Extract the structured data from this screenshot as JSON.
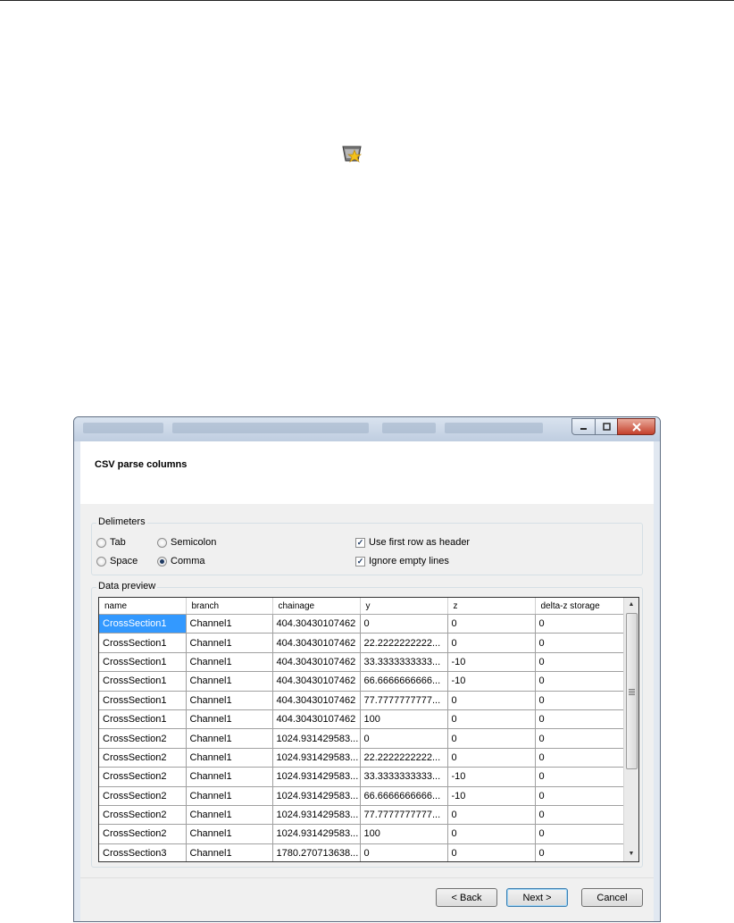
{
  "dialog": {
    "header_title": "CSV parse columns",
    "delimiters_group": {
      "label": "Delimeters",
      "options": [
        {
          "label": "Tab",
          "selected": false
        },
        {
          "label": "Semicolon",
          "selected": false
        },
        {
          "label": "Space",
          "selected": false
        },
        {
          "label": "Comma",
          "selected": true
        }
      ],
      "use_first_row_as_header": {
        "label": "Use first row as header",
        "checked": true
      },
      "ignore_empty_lines": {
        "label": "Ignore empty lines",
        "checked": true
      }
    },
    "preview": {
      "label": "Data preview",
      "columns": [
        "name",
        "branch",
        "chainage",
        "y",
        "z",
        "delta-z storage"
      ],
      "rows": [
        [
          "CrossSection1",
          "Channel1",
          "404.30430107462",
          "0",
          "0",
          "0"
        ],
        [
          "CrossSection1",
          "Channel1",
          "404.30430107462",
          "22.2222222222...",
          "0",
          "0"
        ],
        [
          "CrossSection1",
          "Channel1",
          "404.30430107462",
          "33.3333333333...",
          "-10",
          "0"
        ],
        [
          "CrossSection1",
          "Channel1",
          "404.30430107462",
          "66.6666666666...",
          "-10",
          "0"
        ],
        [
          "CrossSection1",
          "Channel1",
          "404.30430107462",
          "77.7777777777...",
          "0",
          "0"
        ],
        [
          "CrossSection1",
          "Channel1",
          "404.30430107462",
          "100",
          "0",
          "0"
        ],
        [
          "CrossSection2",
          "Channel1",
          "1024.931429583...",
          "0",
          "0",
          "0"
        ],
        [
          "CrossSection2",
          "Channel1",
          "1024.931429583...",
          "22.2222222222...",
          "0",
          "0"
        ],
        [
          "CrossSection2",
          "Channel1",
          "1024.931429583...",
          "33.3333333333...",
          "-10",
          "0"
        ],
        [
          "CrossSection2",
          "Channel1",
          "1024.931429583...",
          "66.6666666666...",
          "-10",
          "0"
        ],
        [
          "CrossSection2",
          "Channel1",
          "1024.931429583...",
          "77.7777777777...",
          "0",
          "0"
        ],
        [
          "CrossSection2",
          "Channel1",
          "1024.931429583...",
          "100",
          "0",
          "0"
        ],
        [
          "CrossSection3",
          "Channel1",
          "1780.270713638...",
          "0",
          "0",
          "0"
        ]
      ]
    },
    "buttons": {
      "back": "< Back",
      "next": "Next >",
      "cancel": "Cancel"
    }
  }
}
